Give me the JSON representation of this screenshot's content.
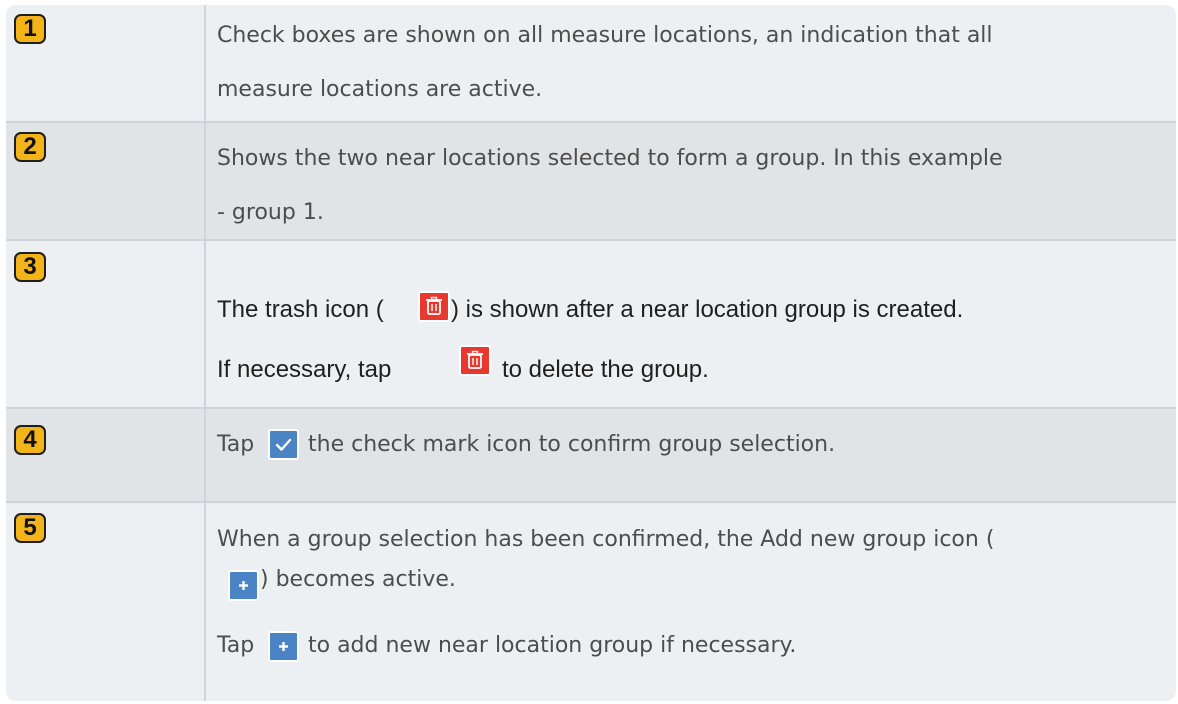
{
  "rows": [
    {
      "step": "1",
      "lines": [
        "Check boxes are shown on all measure locations, an indication that all",
        "measure locations are active."
      ]
    },
    {
      "step": "2",
      "lines": [
        "Shows the two near locations selected to form a group. In this example",
        "- group 1."
      ]
    },
    {
      "step": "3",
      "line1_before": "The trash icon (",
      "line1_after": ") is shown after a near location group is created.",
      "line2_before": "If necessary, tap",
      "line2_after": "to delete the group."
    },
    {
      "step": "4",
      "line_before": "Tap",
      "line_after": "the check mark icon to confirm group selection."
    },
    {
      "step": "5",
      "line1": "When a group selection has been confirmed, the Add new group icon (",
      "line2_after": ") becomes active.",
      "line3_before": "Tap",
      "line3_after": "to add new near location group if necessary."
    }
  ],
  "icons": {
    "trash": "trash-icon",
    "check": "check-mark-icon",
    "plus": "add-new-group-icon"
  },
  "colors": {
    "badge": "#f3b41a",
    "trash": "#e8382f",
    "action_blue": "#4a84c4",
    "row_light": "#edf0f2",
    "row_dark": "#e1e4e7"
  }
}
